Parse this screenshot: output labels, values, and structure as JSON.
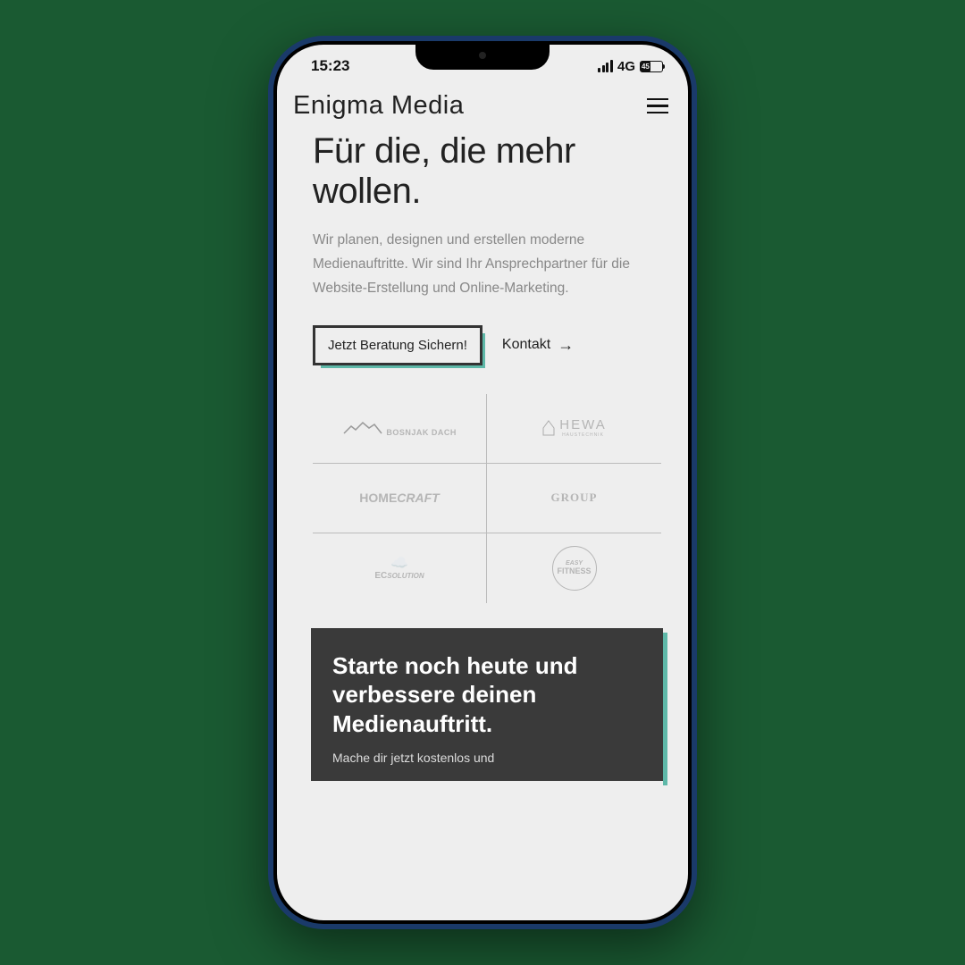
{
  "status": {
    "time": "15:23",
    "network": "4G",
    "battery": "45"
  },
  "header": {
    "brand": "Enigma Media"
  },
  "hero": {
    "title": "Für die, die mehr wollen.",
    "body": "Wir planen, designen und erstellen moderne Medienauftritte. Wir sind Ihr Ansprechpartner für die Website-Erstellung und Online-Marketing.",
    "cta_primary": "Jetzt Beratung Sichern!",
    "cta_secondary": "Kontakt"
  },
  "clients": [
    "BOSNJAK DACH",
    "HEWA HAUSTECHNIK",
    "HOME CRAFT",
    "GROUP",
    "EC SOLUTION",
    "EASY FITNESS"
  ],
  "card": {
    "title": "Starte noch heute und verbessere deinen Medienauftritt.",
    "body": "Mache dir jetzt kostenlos und"
  }
}
